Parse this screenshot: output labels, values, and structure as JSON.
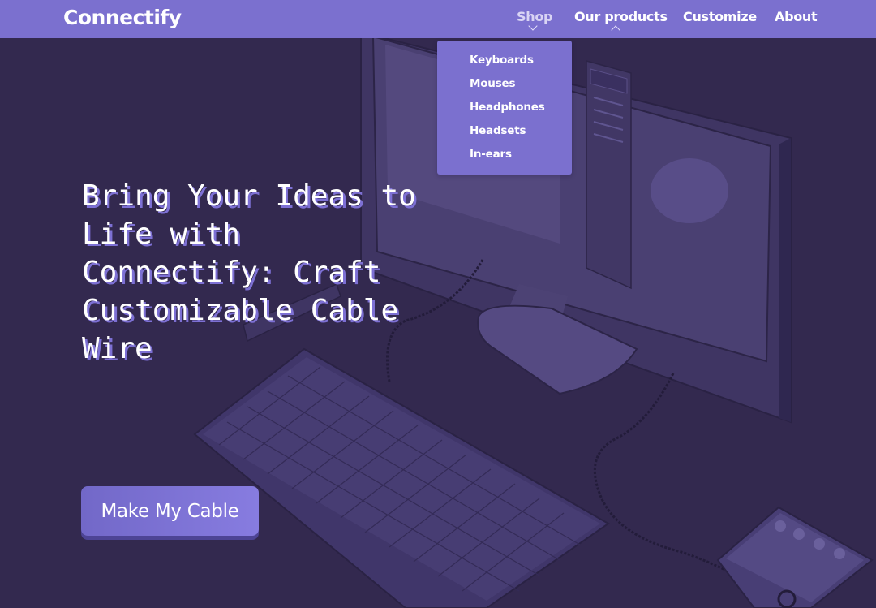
{
  "nav": {
    "brand": "Connectify",
    "links": [
      {
        "label": "Shop",
        "state": "hover"
      },
      {
        "label": "Our products",
        "state": "expanded"
      },
      {
        "label": "Customize"
      },
      {
        "label": "About"
      }
    ],
    "dropdown": {
      "items": [
        "Keyboards",
        "Mouses",
        "Headphones",
        "Headsets",
        "In-ears"
      ]
    }
  },
  "hero": {
    "heading": "Bring Your Ideas to Life with Connectify: Craft Customizable Cable Wire",
    "cta_label": "Make My Cable",
    "illustration": "desk-setup-illustration"
  },
  "colors": {
    "navbar": "#7b70cf",
    "background": "#33294f",
    "heading_shadow": "#7d70d4",
    "cta": "#7b70cf",
    "text": "#ffffff"
  }
}
